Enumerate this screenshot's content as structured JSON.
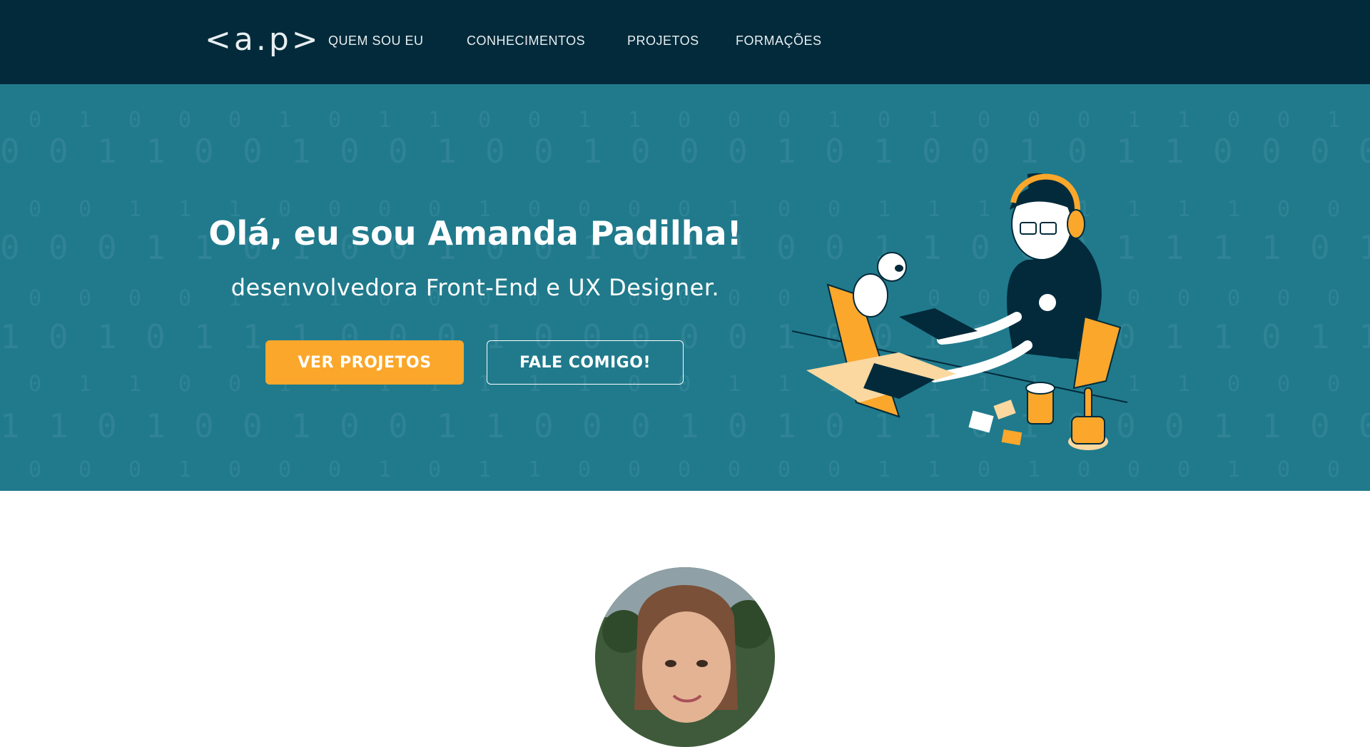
{
  "nav": {
    "logo": "<a.p>",
    "links": [
      "QUEM SOU EU",
      "CONHECIMENTOS",
      "PROJETOS",
      "FORMAÇÕES"
    ]
  },
  "hero": {
    "title": "Olá, eu sou Amanda Padilha!",
    "subtitle": "desenvolvedora Front-End e UX Designer.",
    "primary_button": "VER PROJETOS",
    "secondary_button": "FALE COMIGO!"
  },
  "colors": {
    "navbar_bg": "#022a3a",
    "hero_bg": "#207a8c",
    "accent": "#fba72b",
    "text_light": "#ffffff"
  },
  "icons": [
    "developer-illustration",
    "cat-icon",
    "laptop-icon",
    "cactus-icon",
    "coffee-cup-icon",
    "headphones-icon"
  ]
}
